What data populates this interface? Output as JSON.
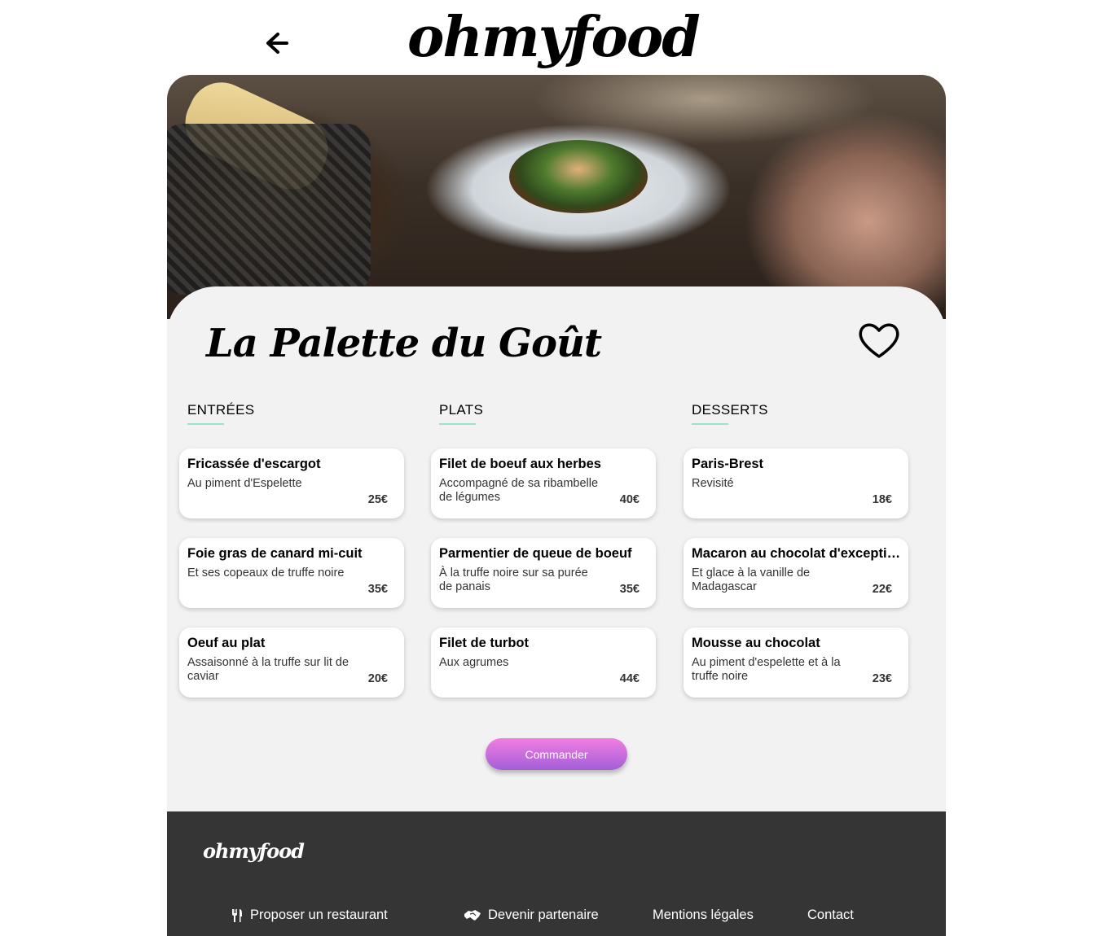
{
  "header": {
    "logo": "ohmyfood",
    "back_icon": "arrow-left-icon"
  },
  "restaurant": {
    "name": "La Palette du Goût",
    "favorite_icon": "heart-outline-icon"
  },
  "menu": {
    "columns": [
      {
        "title": "ENTRÉES",
        "dishes": [
          {
            "name": "Fricassée d'escargot",
            "desc": "Au piment d'Espelette",
            "price": "25€"
          },
          {
            "name": "Foie gras de canard mi-cuit",
            "desc": "Et ses copeaux de truffe noire",
            "price": "35€"
          },
          {
            "name": "Oeuf au plat",
            "desc": "Assaisonné à la truffe sur lit de caviar",
            "price": "20€"
          }
        ]
      },
      {
        "title": "PLATS",
        "dishes": [
          {
            "name": "Filet de boeuf aux herbes",
            "desc": "Accompagné de sa ribambelle de légumes",
            "price": "40€"
          },
          {
            "name": "Parmentier de queue de boeuf",
            "desc": "À la truffe noire sur sa purée de panais",
            "price": "35€"
          },
          {
            "name": "Filet de turbot",
            "desc": "Aux agrumes",
            "price": "44€"
          }
        ]
      },
      {
        "title": "DESSERTS",
        "dishes": [
          {
            "name": "Paris-Brest",
            "desc": "Revisité",
            "price": "18€"
          },
          {
            "name": "Macaron au chocolat d'exceptionnel",
            "desc": "Et glace à la vanille de Madagascar",
            "price": "22€"
          },
          {
            "name": "Mousse au chocolat",
            "desc": "Au piment d'espelette et à la truffe noire",
            "price": "23€"
          }
        ]
      }
    ],
    "order_button": "Commander"
  },
  "footer": {
    "logo": "ohmyfood",
    "links": [
      {
        "label": "Proposer un restaurant",
        "icon": "utensils-icon"
      },
      {
        "label": "Devenir partenaire",
        "icon": "handshake-icon"
      },
      {
        "label": "Mentions légales"
      },
      {
        "label": "Contact"
      }
    ]
  },
  "colors": {
    "accent_underline": "#99e2d0",
    "button_gradient_top": "#f27de2",
    "button_gradient_bottom": "#a25fd8",
    "footer_bg": "#353535",
    "card_bg": "#f2f2f2"
  }
}
